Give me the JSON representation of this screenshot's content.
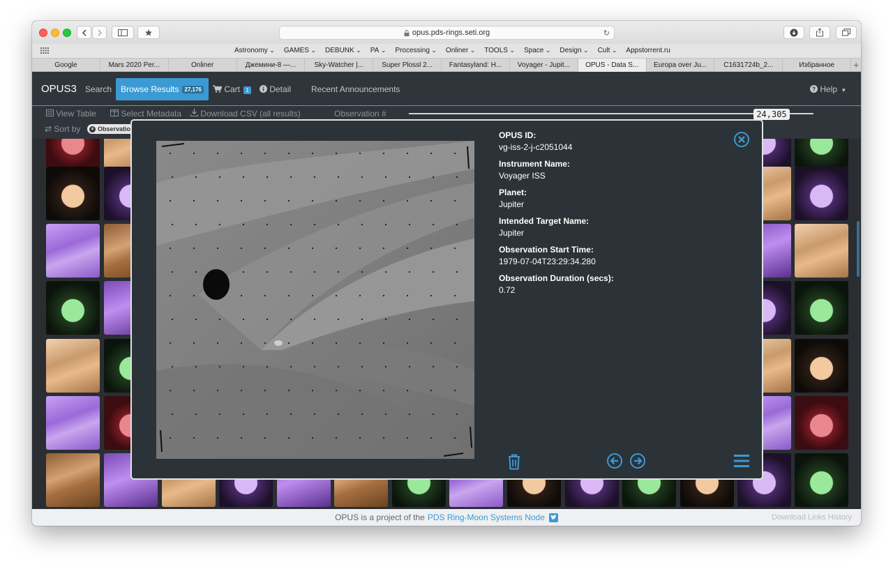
{
  "browser": {
    "url": "opus.pds-rings.seti.org",
    "favorites": [
      "Astronomy",
      "GAMES",
      "DEBUNK",
      "PA",
      "Processing",
      "Onliner",
      "TOOLS",
      "Space",
      "Design",
      "Cult",
      "Appstorrent.ru"
    ],
    "favorites_with_menu": [
      true,
      true,
      true,
      true,
      true,
      true,
      true,
      true,
      true,
      true,
      false
    ],
    "tabs": [
      "Google",
      "Mars 2020 Per...",
      "Onliner",
      "Джемини-8 —...",
      "Sky-Watcher |...",
      "Super Plossl 2...",
      "Fantasyland: H...",
      "Voyager - Jupit...",
      "OPUS - Data S...",
      "Europa over Ju...",
      "C1631724b_2...",
      "Избранное"
    ],
    "active_tab_index": 8
  },
  "nav": {
    "brand": "OPUS3",
    "search": "Search",
    "browse": "Browse Results",
    "browse_count": "27,176",
    "cart": "Cart",
    "cart_count": "1",
    "detail": "Detail",
    "announcements": "Recent Announcements",
    "help": "Help"
  },
  "toolbar": {
    "view_table": "View Table",
    "select_metadata": "Select Metadata",
    "download_csv": "Download CSV (all results)",
    "observation_label": "Observation #",
    "observation_value": "24,305",
    "sort_by": "Sort by",
    "sort_chip": "Observation"
  },
  "modal": {
    "fields": [
      {
        "label": "OPUS ID:",
        "value": "vg-iss-2-j-c2051044"
      },
      {
        "label": "Instrument Name:",
        "value": "Voyager ISS"
      },
      {
        "label": "Planet:",
        "value": "Jupiter"
      },
      {
        "label": "Intended Target Name:",
        "value": "Jupiter"
      },
      {
        "label": "Observation Start Time:",
        "value": "1979-07-04T23:29:34.280"
      },
      {
        "label": "Observation Duration (secs):",
        "value": "0.72"
      }
    ]
  },
  "footer": {
    "text": "OPUS is a project of the",
    "link": "PDS Ring-Moon Systems Node",
    "right": "Download Links History"
  },
  "colors": {
    "accent": "#3b9ad3",
    "nav_bg": "#2f353b",
    "modal_bg": "#2c3338"
  }
}
